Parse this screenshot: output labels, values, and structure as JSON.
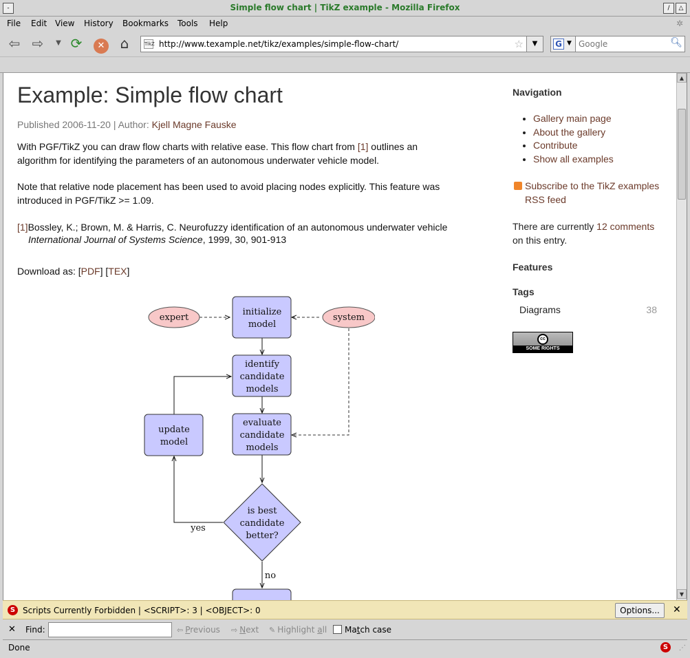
{
  "window": {
    "title": "Simple flow chart | TikZ example - Mozilla Firefox",
    "btn_min": "/",
    "btn_max": "△"
  },
  "menu": [
    "File",
    "Edit",
    "View",
    "History",
    "Bookmarks",
    "Tools",
    "Help"
  ],
  "navbar": {
    "url": "http://www.texample.net/tikz/examples/simple-flow-chart/",
    "favicon_text": "TikZ",
    "search_placeholder": "Google",
    "search_engine_letter": "G"
  },
  "article": {
    "title": "Example: Simple flow chart",
    "published_prefix": "Published 2006-11-20 | Author:",
    "author": "Kjell Magne Fauske",
    "p1_before": "With PGF/TikZ you can draw flow charts with relative ease. This flow chart from ",
    "p1_ref": "[1]",
    "p1_line1_after": " outlines an",
    "p1_line2": "algorithm for identifying the parameters of an autonomous underwater vehicle model.",
    "p2_line1": "Note that relative node placement has been used to avoid placing nodes explicitly. This feature was",
    "p2_line2": "introduced in PGF/TikZ >= 1.09.",
    "ref_label": "[1]",
    "ref_text": "Bossley, K.; Brown, M. & Harris, C. Neurofuzzy identification of an autonomous underwater vehicle",
    "ref_journal": "International Journal of Systems Science",
    "ref_rest": ", 1999, 30, 901-913",
    "download_label": "Download as:",
    "download_pdf": "PDF",
    "download_tex": "TEX"
  },
  "flowchart": {
    "expert": "expert",
    "system": "system",
    "init": [
      "initialize",
      "model"
    ],
    "identify": [
      "identify",
      "candidate",
      "models"
    ],
    "evaluate": [
      "evaluate",
      "candidate",
      "models"
    ],
    "update": [
      "update",
      "model"
    ],
    "decision": [
      "is best",
      "candidate",
      "better?"
    ],
    "yes": "yes",
    "no": "no"
  },
  "sidebar": {
    "nav_title": "Navigation",
    "nav_items": [
      "Gallery main page",
      "About the gallery",
      "Contribute",
      "Show all examples"
    ],
    "rss_line1": "Subscribe to the TikZ examples",
    "rss_line2": "RSS feed",
    "comments_before": "There are currently ",
    "comments_link": "12 comments",
    "comments_after": "on this entry.",
    "features_title": "Features",
    "tags_title": "Tags",
    "tag_name": "Diagrams",
    "tag_count": "38",
    "cc_logo": "cc",
    "cc_text": "SOME RIGHTS RESERVED"
  },
  "noscript": {
    "message": "Scripts Currently Forbidden | <SCRIPT>: 3 | <OBJECT>: 0",
    "options_label": "Options...",
    "icon": "S"
  },
  "findbar": {
    "label": "Find:",
    "previous_pre": "",
    "previous_u": "P",
    "previous_post": "revious",
    "next_pre": "",
    "next_u": "N",
    "next_post": "ext",
    "highlight_pre": "Highlight ",
    "highlight_u": "a",
    "highlight_post": "ll",
    "match_pre": "Ma",
    "match_u": "t",
    "match_post": "ch case"
  },
  "status": {
    "text": "Done"
  },
  "colors": {
    "title_green": "#2a7a2a",
    "link_brown": "#6b3a2a",
    "node_fill": "#c9c9ff",
    "ellipse_fill": "#f8c8c8",
    "noscript_bg": "#f1e6b7"
  }
}
